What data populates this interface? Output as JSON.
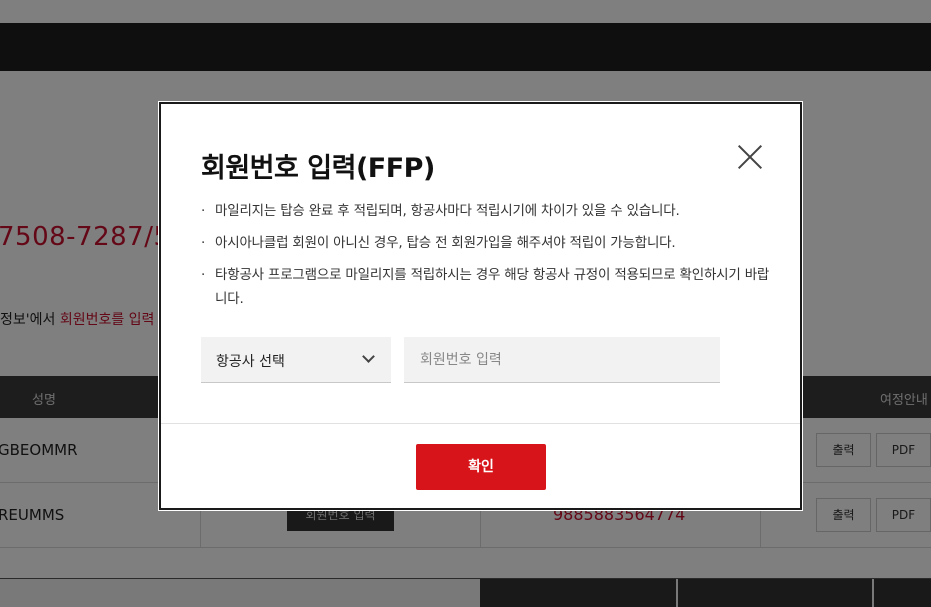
{
  "background": {
    "booking_number": "7508-7287/5",
    "hint_prefix": "정보'에서 ",
    "hint_highlight": "회원번호를 입력",
    "table": {
      "headers": {
        "name": "성명",
        "itinerary": "여정안내"
      },
      "rows": [
        {
          "name": "GBEOMMR",
          "print": "출력",
          "pdf": "PDF"
        },
        {
          "name": "REUMMS",
          "ffp_button": "회원번호 입력",
          "ffp_number": "9885883564774",
          "print": "출력",
          "pdf": "PDF"
        }
      ]
    }
  },
  "modal": {
    "title": "회원번호 입력(FFP)",
    "notes": [
      "마일리지는 탑승 완료 후 적립되며, 항공사마다 적립시기에 차이가 있을 수 있습니다.",
      "아시아나클럽 회원이 아니신 경우, 탑승 전 회원가입을 해주셔야 적립이 가능합니다.",
      "타항공사 프로그램으로 마일리지를 적립하시는 경우 해당 항공사 규정이 적용되므로 확인하시기 바랍니다."
    ],
    "airline_select": {
      "selected": "항공사 선택"
    },
    "member_input": {
      "value": "",
      "placeholder": "회원번호 입력"
    },
    "confirm_label": "확인"
  },
  "colors": {
    "brand_red": "#d7141a",
    "highlight_red": "#c8102e",
    "dark_header": "#1e1e1e"
  }
}
